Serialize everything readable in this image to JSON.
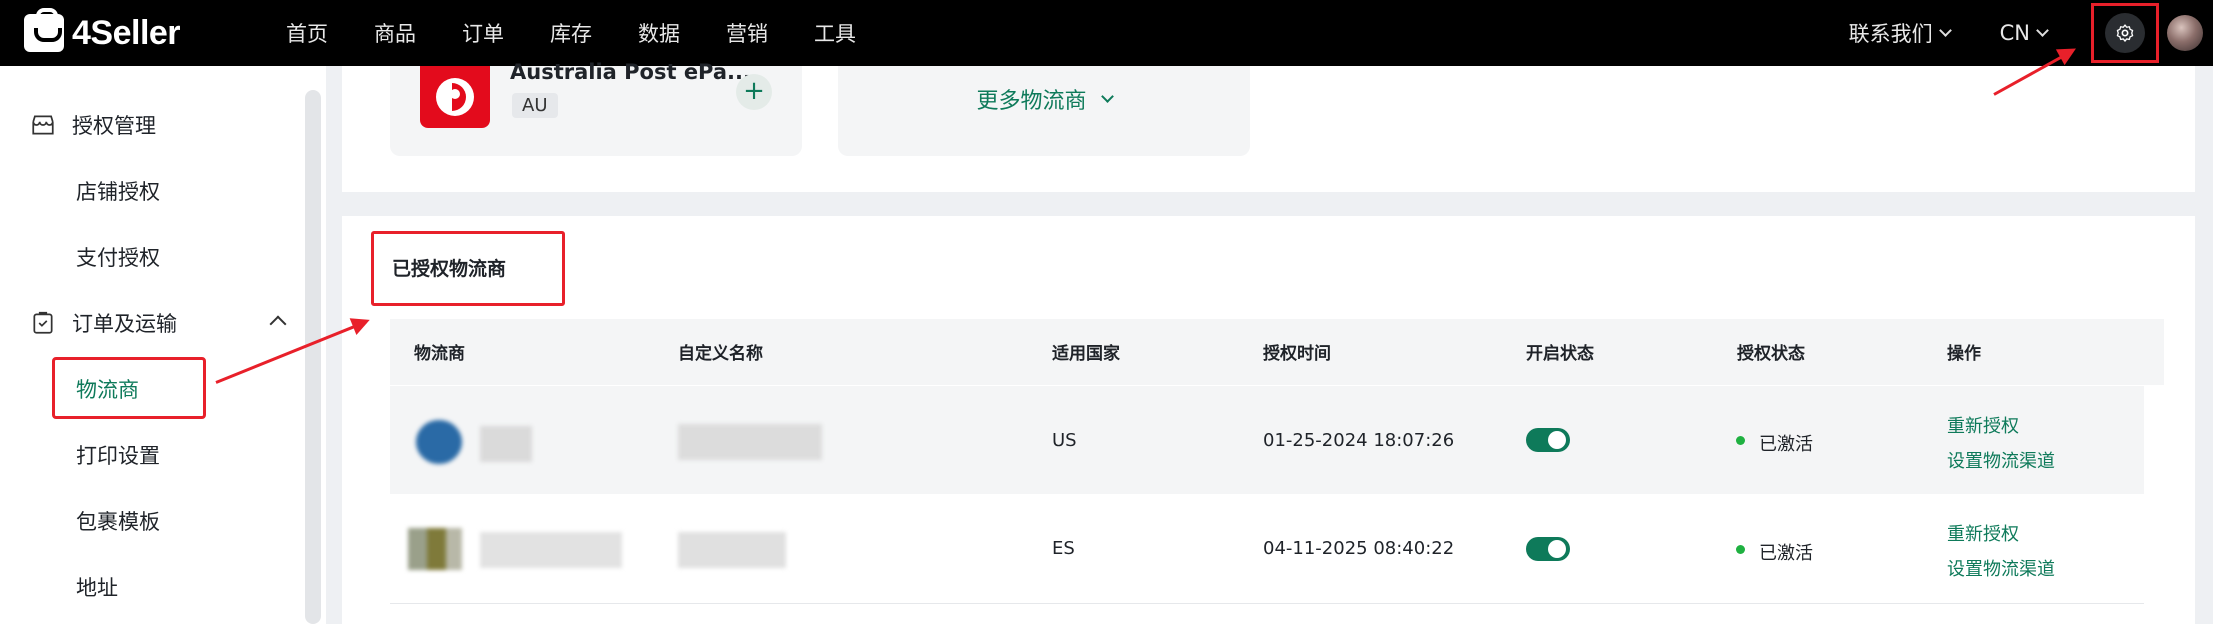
{
  "app": {
    "logo_text": "4Seller"
  },
  "nav": {
    "items": [
      "首页",
      "商品",
      "订单",
      "库存",
      "数据",
      "营销",
      "工具"
    ]
  },
  "topright": {
    "contact": "联系我们",
    "lang": "CN"
  },
  "sidebar": {
    "group1": "授权管理",
    "group1_items": [
      "店铺授权",
      "支付授权"
    ],
    "group2": "订单及运输",
    "group2_items": [
      "物流商",
      "打印设置",
      "包裹模板",
      "地址"
    ]
  },
  "carriers": {
    "card_name": "Australia Post ePa...",
    "card_tag": "AU",
    "add_label": "+",
    "more_label": "更多物流商"
  },
  "section": {
    "title": "已授权物流商"
  },
  "table": {
    "headers": [
      "物流商",
      "自定义名称",
      "适用国家",
      "授权时间",
      "开启状态",
      "授权状态",
      "操作"
    ],
    "rows": [
      {
        "country": "US",
        "time": "01-25-2024 18:07:26",
        "status": "已激活",
        "action1": "重新授权",
        "action2": "设置物流渠道"
      },
      {
        "country": "ES",
        "time": "04-11-2025 08:40:22",
        "status": "已激活",
        "action1": "重新授权",
        "action2": "设置物流渠道"
      }
    ]
  },
  "colors": {
    "accent": "#0e7a5a",
    "annotation": "#e8202a",
    "active_dot": "#1fb141",
    "auspost_red": "#e30b1c"
  }
}
